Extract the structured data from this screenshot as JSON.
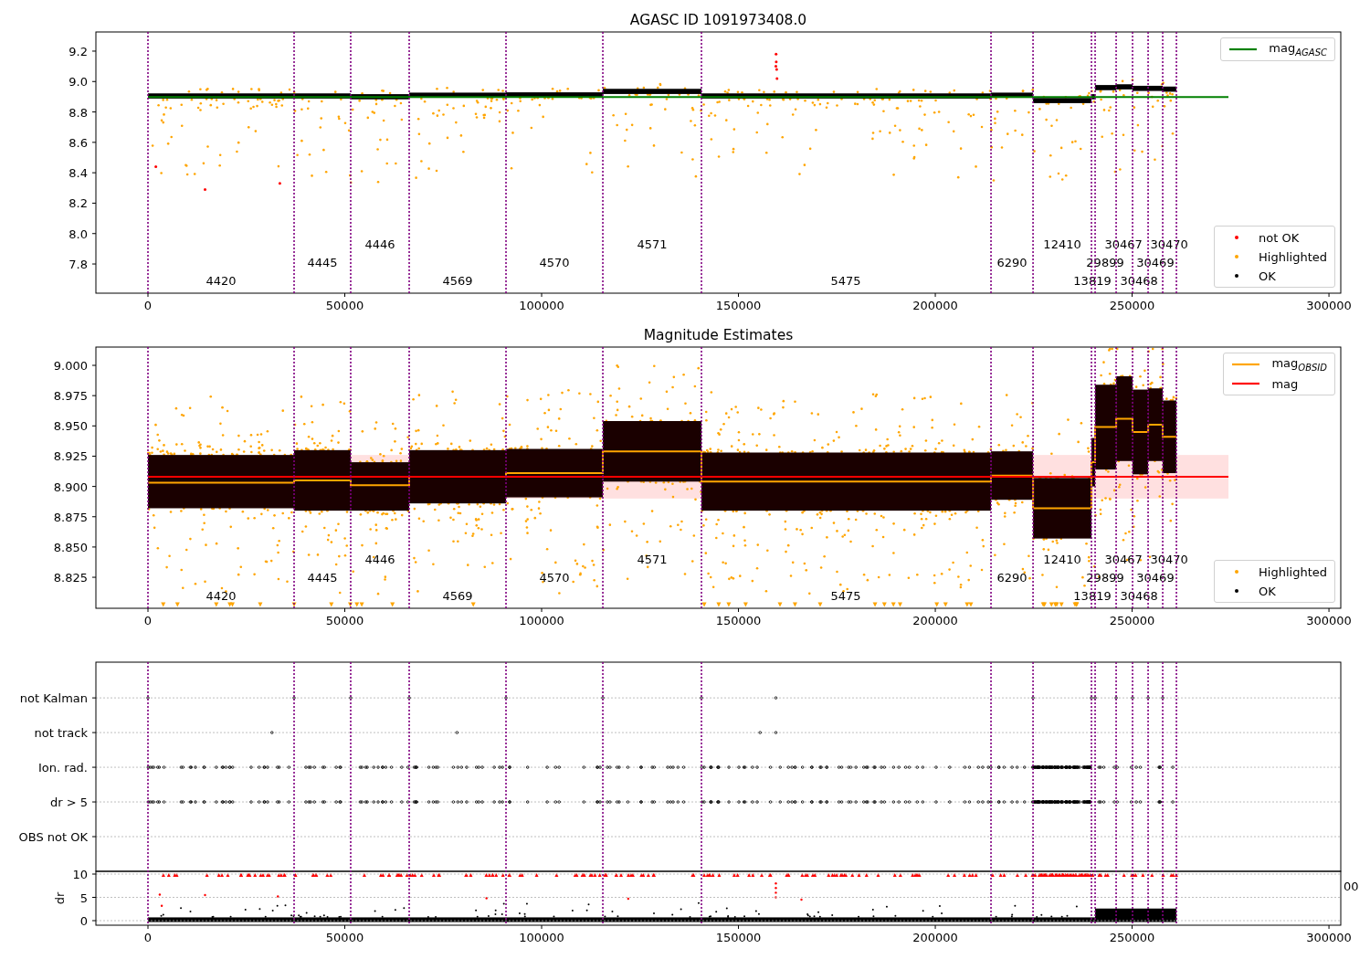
{
  "panels": [
    {
      "kind": "magnitude",
      "title": "AGASC ID 1091973408.0",
      "obsid_labels": [
        "4446",
        "4571",
        "12410",
        "30467",
        "30470",
        "4445",
        "4570",
        "6290",
        "29899",
        "30469",
        "4420",
        "4569",
        "5475",
        "13819",
        "30468"
      ],
      "legend": {
        "entries": [
          {
            "kind": "dot",
            "label": "not OK",
            "color": "#ff0000"
          },
          {
            "kind": "dot",
            "label": "Highlighted",
            "color": "#ffa500"
          },
          {
            "kind": "dot",
            "label": "OK",
            "color": "#000000"
          }
        ]
      },
      "chart_data": {
        "type": "line",
        "xlim": [
          -13225,
          303000
        ],
        "ylim": [
          7.608,
          9.326
        ],
        "xticks": [
          {
            "value": 0,
            "label": "0"
          },
          {
            "value": 50000,
            "label": "50000"
          },
          {
            "value": 100000,
            "label": "100000"
          },
          {
            "value": 150000,
            "label": "150000"
          },
          {
            "value": 200000,
            "label": "200000"
          },
          {
            "value": 250000,
            "label": "250000"
          },
          {
            "value": 300000,
            "label": "300000"
          }
        ],
        "yticks": [
          {
            "value": 7.8,
            "label": "7.8"
          },
          {
            "value": 8.0,
            "label": "8.0"
          },
          {
            "value": 8.2,
            "label": "8.2"
          },
          {
            "value": 8.4,
            "label": "8.4"
          },
          {
            "value": 8.6,
            "label": "8.6"
          },
          {
            "value": 8.8,
            "label": "8.8"
          },
          {
            "value": 9.0,
            "label": "9.0"
          },
          {
            "value": 9.2,
            "label": "9.2"
          }
        ],
        "x": [
          0,
          274470
        ],
        "series": [
          {
            "name": "mag$_{AGASC}$",
            "color": "#008000",
            "values": [
              8.898,
              8.898
            ]
          }
        ]
      }
    },
    {
      "kind": "estimates",
      "title": "Magnitude Estimates",
      "obsid_labels": [
        "4446",
        "4571",
        "12410",
        "30467",
        "30470",
        "4445",
        "4570",
        "6290",
        "29899",
        "30469",
        "4420",
        "4569",
        "5475",
        "13819",
        "30468"
      ],
      "legend": {
        "entries": [
          {
            "kind": "dot",
            "label": "Highlighted",
            "color": "#ffa500"
          },
          {
            "kind": "dot",
            "label": "OK",
            "color": "#000000"
          }
        ]
      },
      "chart_data": {
        "type": "line",
        "xlim": [
          -13225,
          303000
        ],
        "ylim": [
          8.7994,
          9.0151
        ],
        "xticks": [
          {
            "value": 0,
            "label": "0"
          },
          {
            "value": 50000,
            "label": "50000"
          },
          {
            "value": 100000,
            "label": "100000"
          },
          {
            "value": 150000,
            "label": "150000"
          },
          {
            "value": 200000,
            "label": "200000"
          },
          {
            "value": 250000,
            "label": "250000"
          },
          {
            "value": 300000,
            "label": "300000"
          }
        ],
        "yticks": [
          {
            "value": 8.825,
            "label": "8.825"
          },
          {
            "value": 8.85,
            "label": "8.850"
          },
          {
            "value": 8.875,
            "label": "8.875"
          },
          {
            "value": 8.9,
            "label": "8.900"
          },
          {
            "value": 8.925,
            "label": "8.925"
          },
          {
            "value": 8.95,
            "label": "8.950"
          },
          {
            "value": 8.975,
            "label": "8.975"
          },
          {
            "value": 9.0,
            "label": "9.000"
          }
        ],
        "x": [
          0,
          37120,
          37120,
          51500,
          51500,
          66360,
          66360,
          90950,
          90950,
          115550,
          115550,
          140600,
          140600,
          214150,
          214150,
          224830,
          224830,
          239670,
          239670,
          240600,
          240600,
          245940,
          245940,
          250110,
          250110,
          254060,
          254060,
          257770,
          257770,
          261250,
          274470
        ],
        "series": [
          {
            "name": "mag$_{OBSID}$",
            "color": "#ffa500",
            "values": [
              8.903,
              8.903,
              8.905,
              8.905,
              8.901,
              8.901,
              8.908,
              8.908,
              8.911,
              8.911,
              8.929,
              8.929,
              8.904,
              8.904,
              8.909,
              8.909,
              8.882,
              8.882,
              8.92,
              8.92,
              8.949,
              8.949,
              8.956,
              8.956,
              8.945,
              8.945,
              8.951,
              8.951,
              8.941,
              8.941,
              null
            ]
          },
          {
            "name": "mag",
            "color": "#ff0000",
            "values": [
              8.908,
              8.908,
              8.908,
              8.908,
              8.908,
              8.908,
              8.908,
              8.908,
              8.908,
              8.908,
              8.908,
              8.908,
              8.908,
              8.908,
              8.908,
              8.908,
              8.908,
              8.908,
              8.908,
              8.908,
              8.908,
              8.908,
              8.908,
              8.908,
              8.908,
              8.908,
              8.908,
              8.908,
              8.908,
              8.908,
              8.908
            ]
          }
        ]
      }
    },
    {
      "kind": "flags",
      "rows": [
        "not Kalman",
        "not track",
        "Ion. rad.",
        "dr > 5",
        "OBS not OK"
      ],
      "tick_fragment": "00"
    },
    {
      "kind": "dr",
      "chart_data": {
        "type": "scatter",
        "ylabel": "dr",
        "grid": true,
        "xlim": [
          -13225,
          303000
        ],
        "ylim": [
          -0.98,
          10.59
        ],
        "xticks": [
          {
            "value": 0,
            "label": "0"
          },
          {
            "value": 50000,
            "label": "50000"
          },
          {
            "value": 100000,
            "label": "100000"
          },
          {
            "value": 150000,
            "label": "150000"
          },
          {
            "value": 200000,
            "label": "200000"
          },
          {
            "value": 250000,
            "label": "250000"
          },
          {
            "value": 300000,
            "label": "300000"
          }
        ],
        "yticks": [
          {
            "value": 0,
            "label": "0"
          },
          {
            "value": 5,
            "label": "5"
          },
          {
            "value": 10,
            "label": "10"
          }
        ]
      }
    }
  ]
}
